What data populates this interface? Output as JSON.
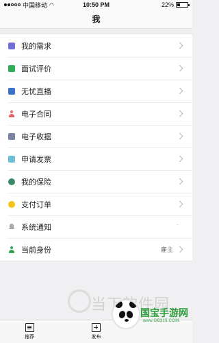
{
  "status_bar": {
    "carrier": "中国移动",
    "time": "10:50 PM",
    "battery": "22%"
  },
  "nav": {
    "title": "我"
  },
  "menu": {
    "items": [
      {
        "label": "我的需求",
        "icon": "demand-icon",
        "value": ""
      },
      {
        "label": "面试评价",
        "icon": "review-icon",
        "value": ""
      },
      {
        "label": "无忧直播",
        "icon": "live-tv-icon",
        "value": ""
      },
      {
        "label": "电子合同",
        "icon": "contract-icon",
        "value": ""
      },
      {
        "label": "电子收据",
        "icon": "receipt-icon",
        "value": ""
      },
      {
        "label": "申请发票",
        "icon": "invoice-icon",
        "value": ""
      },
      {
        "label": "我的保险",
        "icon": "insurance-icon",
        "value": ""
      },
      {
        "label": "支付订单",
        "icon": "order-icon",
        "value": ""
      },
      {
        "label": "系统通知",
        "icon": "bell-icon",
        "value": ""
      },
      {
        "label": "当前身份",
        "icon": "identity-icon",
        "value": "雇主"
      }
    ]
  },
  "tabs": [
    {
      "label": "推荐",
      "icon": "document-icon"
    },
    {
      "label": "发布",
      "icon": "add-icon"
    },
    {
      "label": "",
      "icon": "person-icon"
    }
  ],
  "watermark": {
    "text": "当下软件园",
    "brand": "国宝手游网",
    "url": "www.GB315.COM"
  },
  "colors": {
    "brand_green": "#2a9d3a",
    "chevron": "#b5b5b5",
    "contract_red": "#e06666",
    "identity_green": "#34a853"
  }
}
